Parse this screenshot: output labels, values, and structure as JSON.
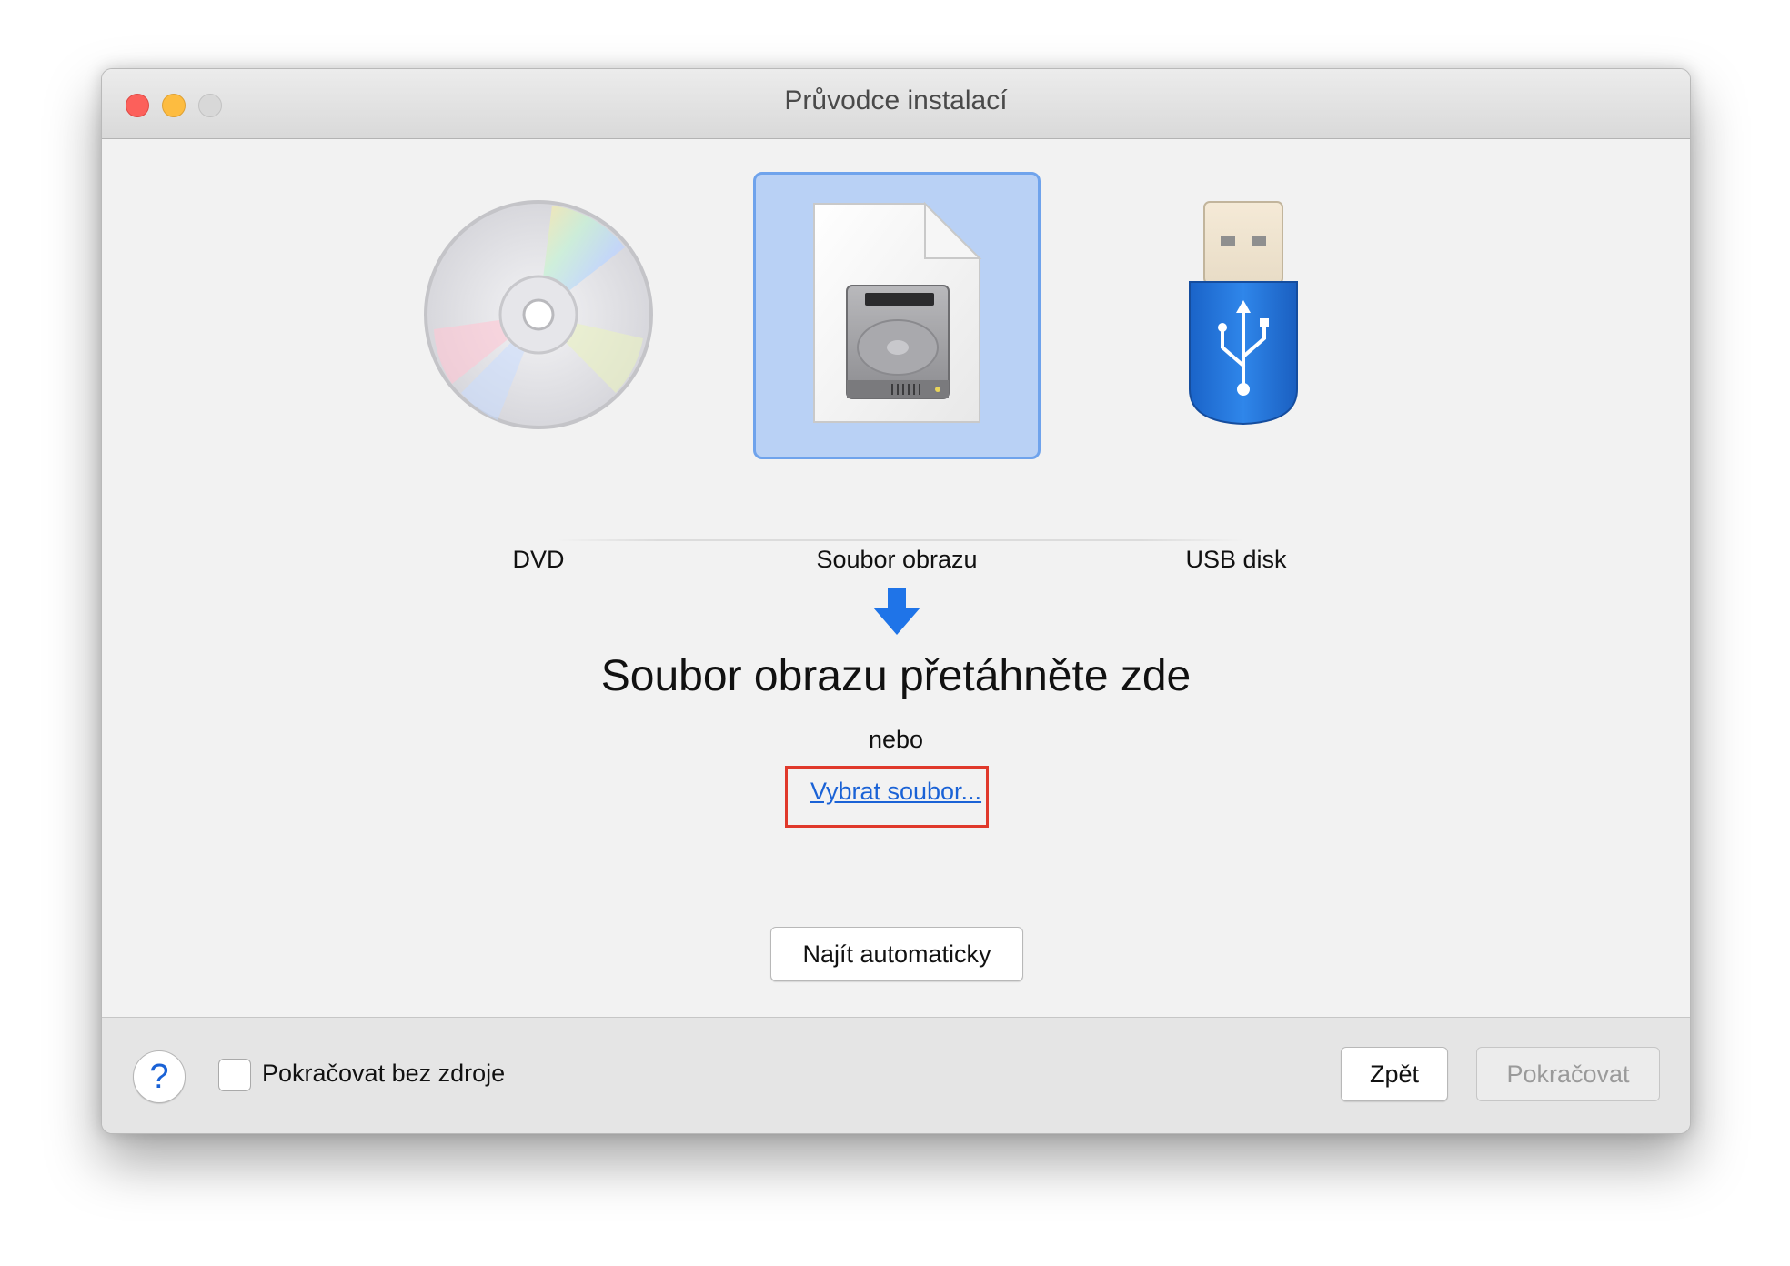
{
  "window": {
    "title": "Průvodce instalací"
  },
  "sources": [
    {
      "label": "DVD",
      "icon": "dvd-disc-icon",
      "selected": false
    },
    {
      "label": "Soubor obrazu",
      "icon": "disk-image-file-icon",
      "selected": true
    },
    {
      "label": "USB disk",
      "icon": "usb-drive-icon",
      "selected": false
    }
  ],
  "drop_area": {
    "arrow_icon": "down-arrow-icon",
    "headline": "Soubor obrazu přetáhněte zde",
    "or_text": "nebo",
    "choose_link": "Vybrat soubor..."
  },
  "auto_button": "Najít automaticky",
  "footer": {
    "help_label": "?",
    "checkbox_label": "Pokračovat bez zdroje",
    "checkbox_checked": false,
    "back_label": "Zpět",
    "continue_label": "Pokračovat"
  },
  "colors": {
    "accent": "#1a62d6",
    "selection_fill": "#b9d1f5",
    "selection_border": "#6fa3ec",
    "highlight_frame": "#e0392b"
  }
}
